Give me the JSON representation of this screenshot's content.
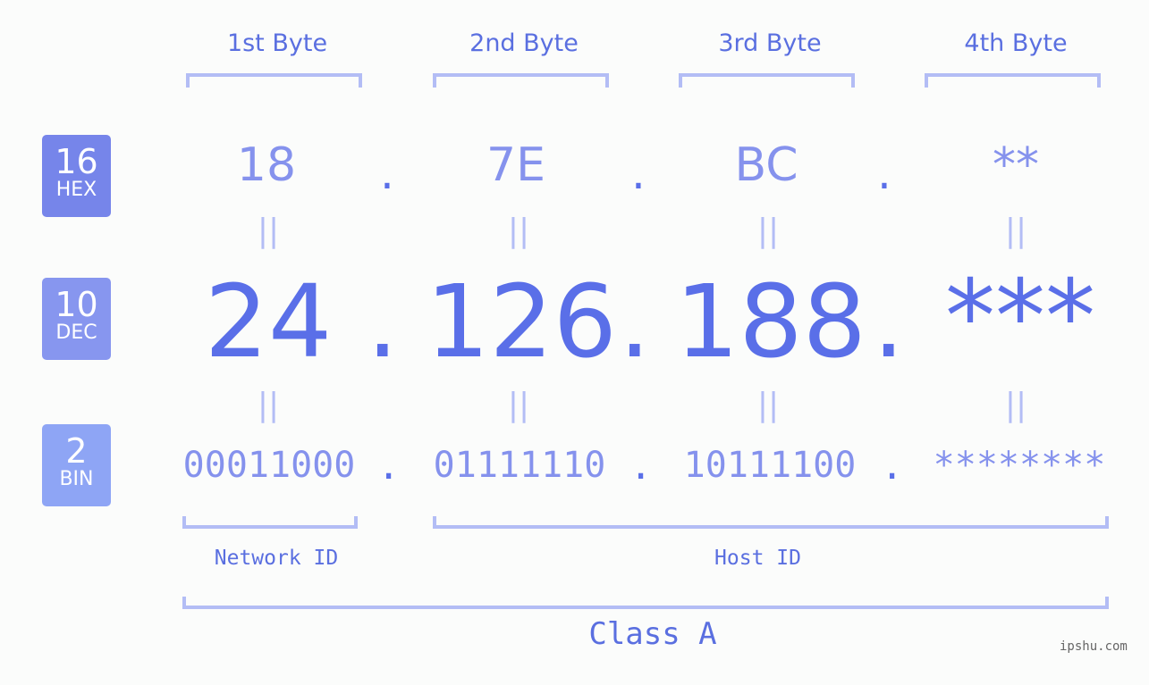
{
  "bytes": {
    "headers": [
      "1st Byte",
      "2nd Byte",
      "3rd Byte",
      "4th Byte"
    ]
  },
  "badges": {
    "hex": {
      "base": "16",
      "label": "HEX",
      "color": "#7685ea"
    },
    "dec": {
      "base": "10",
      "label": "DEC",
      "color": "#8796ef"
    },
    "bin": {
      "base": "2",
      "label": "BIN",
      "color": "#8ea5f5"
    }
  },
  "hex": [
    "18",
    "7E",
    "BC",
    "**"
  ],
  "dec": [
    "24",
    "126",
    "188",
    "***"
  ],
  "bin": [
    "00011000",
    "01111110",
    "10111100",
    "********"
  ],
  "separator": ".",
  "equals": "||",
  "segments": {
    "network": "Network ID",
    "host": "Host ID",
    "class": "Class A"
  },
  "watermark": "ipshu.com",
  "colors": {
    "accent": "#5a6fe8",
    "light": "#8592ed",
    "bracket": "#b3bdf5"
  }
}
